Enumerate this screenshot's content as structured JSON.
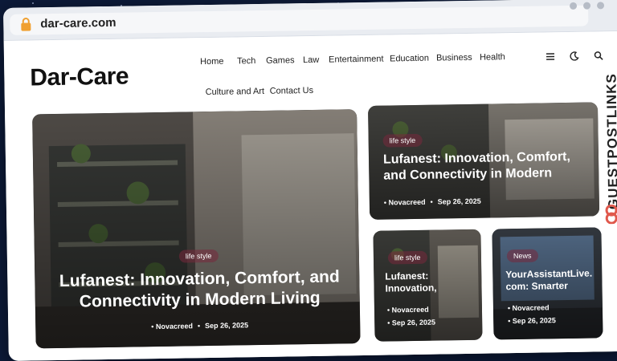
{
  "browser": {
    "url": "dar-care.com"
  },
  "site": {
    "logo": "Dar-Care"
  },
  "nav": {
    "items": [
      "Home",
      "Tech",
      "Games",
      "Law",
      "Entertainment",
      "Education",
      "Business",
      "Health",
      "Culture and Art",
      "Contact Us"
    ]
  },
  "header_icons": {
    "menu": "hamburger-icon",
    "theme": "moon-icon",
    "search": "search-icon"
  },
  "brand_side": {
    "text": "GUESTPOSTLINKS",
    "icon": "link-chain-icon"
  },
  "cards": {
    "hero": {
      "category": "life style",
      "title": "Lufanest: Innovation, Comfort, and Connectivity in Modern Living",
      "author": "Novacreed",
      "date": "Sep 26, 2025"
    },
    "top_right": {
      "category": "life style",
      "title": "Lufanest: Innovation, Comfort, and Connectivity in Modern",
      "author": "Novacreed",
      "date": "Sep 26, 2025"
    },
    "small_left": {
      "category": "life style",
      "title": "Lufanest: Innovation,",
      "author": "Novacreed",
      "date": "Sep 26, 2025"
    },
    "small_right": {
      "category": "News",
      "title": "YourAssistantLive. com: Smarter",
      "author": "Novacreed",
      "date": "Sep 26, 2025"
    }
  },
  "colors": {
    "background": "#0d1b3a",
    "accent": "#e0584c",
    "badge": "#7a2a3e"
  }
}
